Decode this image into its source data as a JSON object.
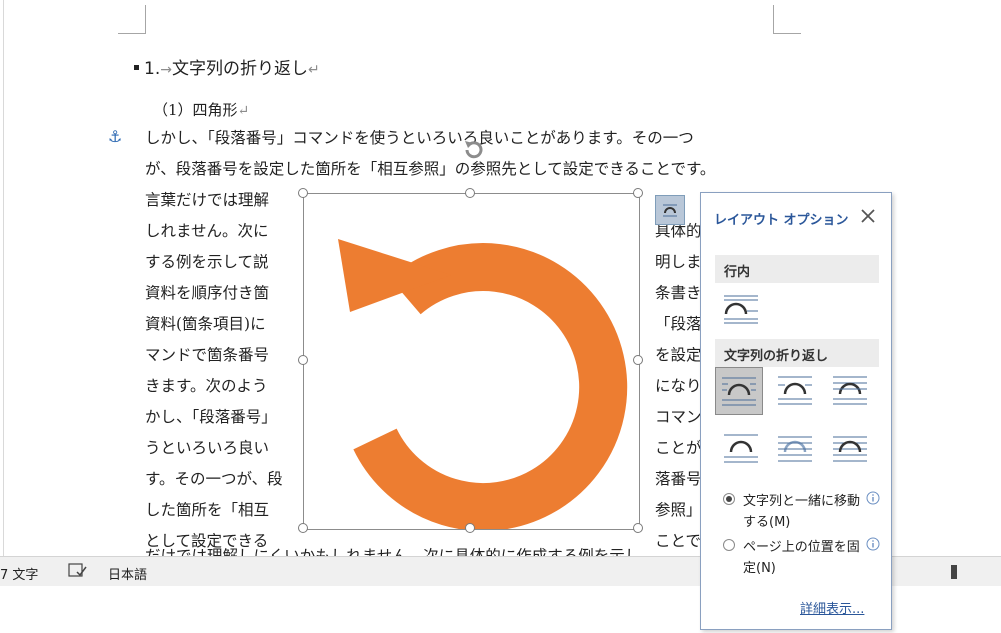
{
  "document": {
    "heading1": {
      "number": "1.",
      "tab_mark": "→",
      "text": "文字列の折り返し",
      "para_mark": "↵"
    },
    "heading2": {
      "text": "（1）四角形",
      "para_mark": "↵"
    },
    "full_lines": [
      "しかし、「段落番号」コマンドを使うといろいろ良いことがあります。その一つ",
      "が、段落番号を設定した箇所を「相互参照」の参照先として設定できることです。"
    ],
    "left_lines": [
      "言葉だけでは理解",
      "しれません。次に",
      "する例を示して説",
      "資料を順序付き箇",
      "資料(箇条項目)に",
      "マンドで箇条番号",
      "きます。次のよう",
      "かし、「段落番号」",
      "うといろいろ良い",
      "す。その一つが、段",
      "した箇所を「相互",
      "として設定できる"
    ],
    "right_lines": [
      "",
      "具体的",
      "明しま",
      "条書き",
      "「段落",
      "を設定",
      "になり",
      "コマン",
      "ことが",
      "落番号",
      "参照」",
      "ことで"
    ],
    "bottom_line": "だけでは理解しにくいかもしれません。次に具体的に作成する例を示し",
    "image": {
      "shape": "circular-arrow",
      "color": "#ED7D31"
    }
  },
  "statusbar": {
    "word_count": "7 文字",
    "language": "日本語"
  },
  "layout_options": {
    "title": "レイアウト オプション",
    "inline_section": "行内",
    "wrap_section": "文字列の折り返し",
    "radio_move": "文字列と一緒に移動する(M)",
    "radio_fix": "ページ上の位置を固定(N)",
    "more_link": "詳細表示..."
  },
  "colors": {
    "accent": "#2b579a",
    "arrow": "#ED7D31"
  }
}
